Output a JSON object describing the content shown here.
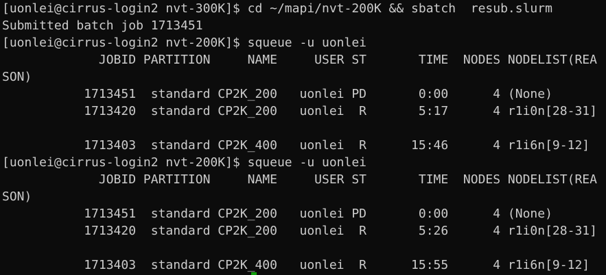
{
  "terminal": {
    "lines": [
      "[uonlei@cirrus-login2 nvt-300K]$ cd ~/mapi/nvt-200K && sbatch  resub.slurm",
      "Submitted batch job 1713451",
      "[uonlei@cirrus-login2 nvt-200K]$ squeue -u uonlei",
      "             JOBID PARTITION     NAME     USER ST       TIME  NODES NODELIST(REA",
      "SON)",
      "           1713451  standard CP2K_200   uonlei PD       0:00      4 (None)",
      "           1713420  standard CP2K_200   uonlei  R       5:17      4 r1i0n[28-31]",
      "",
      "           1713403  standard CP2K_400   uonlei  R      15:46      4 r1i6n[9-12]",
      "[uonlei@cirrus-login2 nvt-200K]$ squeue -u uonlei",
      "             JOBID PARTITION     NAME     USER ST       TIME  NODES NODELIST(REA",
      "SON)",
      "           1713451  standard CP2K_200   uonlei PD       0:00      4 (None)",
      "           1713420  standard CP2K_200   uonlei  R       5:26      4 r1i0n[28-31]",
      "",
      "           1713403  standard CP2K_400   uonlei  R      15:55      4 r1i6n[9-12]"
    ]
  }
}
